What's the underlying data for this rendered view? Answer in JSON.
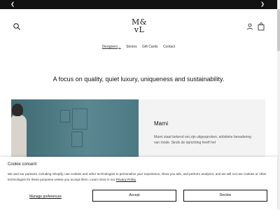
{
  "announcement": {
    "prev_icon": "chevron-left-icon",
    "next_icon": "chevron-right-icon"
  },
  "header": {
    "logo_line1": "M&",
    "logo_line2": "vL",
    "icons": [
      "search-icon",
      "user-icon",
      "shopping-bag-icon"
    ]
  },
  "nav": {
    "items": [
      {
        "label": "Designers",
        "has_dropdown": true
      },
      {
        "label": "Stories"
      },
      {
        "label": "Gift Cards"
      },
      {
        "label": "Contact"
      }
    ]
  },
  "tagline": "A focus on quality, quiet luxury, uniqueness and sustainability.",
  "feature": {
    "title": "Marni",
    "text": "Marni staat bekend om zijn uitgesproken, artistieke benadering van mode. Sinds de oprichting heeft het"
  },
  "cookie": {
    "title": "Cookie consent",
    "text": "We and our partners, including Shopify, use cookies and other technologies to personalize your experience, show you ads, and perform analytics, and we will not use cookies or other technologies for these purposes unless you accept them. Learn more in our",
    "link": "Privacy Policy",
    "manage_label": "Manage preferences",
    "accept_label": "Accept",
    "decline_label": "Decline"
  },
  "colors": {
    "announcement_bar": "#121212",
    "wall": "#4d7781",
    "panel": "#f3f3f3"
  }
}
